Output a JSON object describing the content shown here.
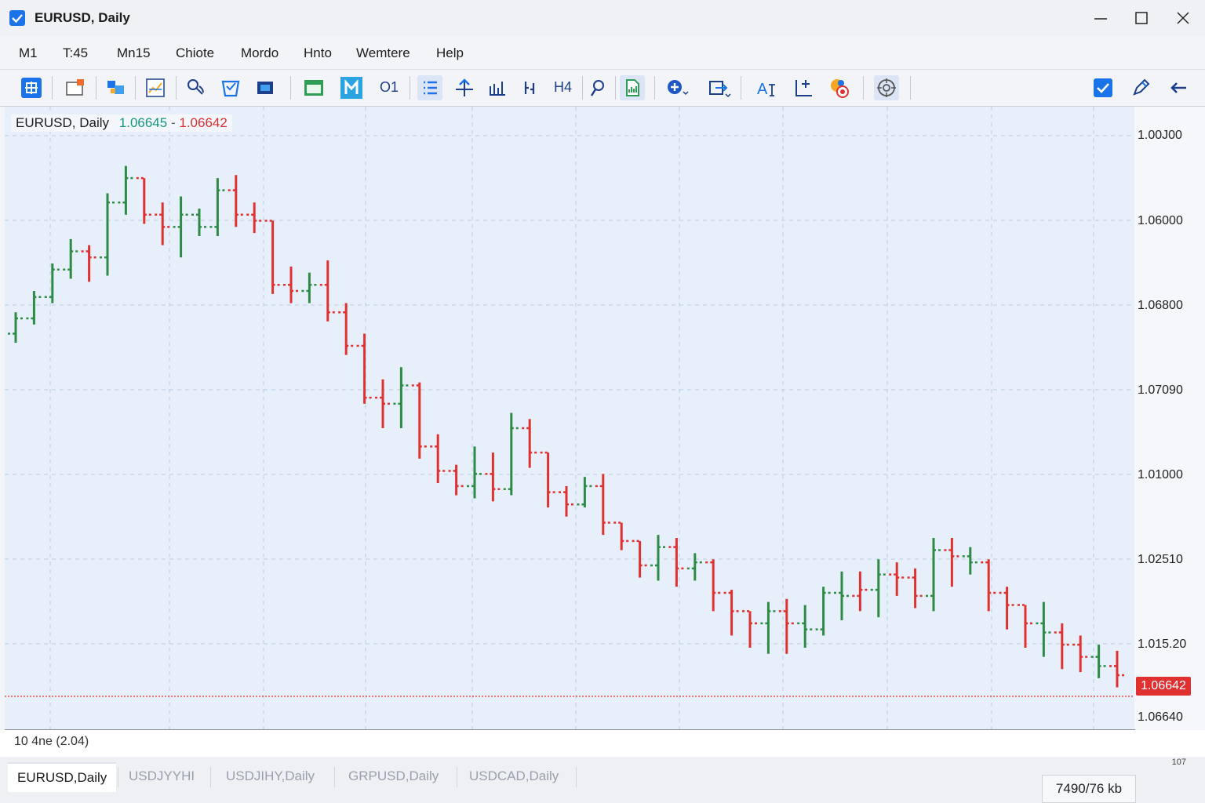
{
  "window": {
    "title": "EURUSD, Daily",
    "checkbox_icon": "check-icon"
  },
  "menu": {
    "items": [
      "M1",
      "T:45",
      "Mn15",
      "Chiote",
      "Mordo",
      "Hnto",
      "Wemtere",
      "Help"
    ]
  },
  "toolbar": {
    "text_buttons": {
      "o1": "O1",
      "h4": "H4"
    },
    "icons": [
      "new-chart-icon",
      "profiles-icon",
      "market-watch-icon",
      "navigator-icon",
      "signals-icon",
      "strategy-tester-icon",
      "terminal-icon",
      "bar-chart-icon",
      "candlestick-icon",
      "o1-timeframe",
      "line-list-icon",
      "crosshair-icon",
      "bar-chart-small-icon",
      "period-separator-icon",
      "h4-timeframe",
      "zoom-icon",
      "template-icon",
      "add-indicator-icon",
      "objects-icon",
      "text-label-icon",
      "cursor-icon",
      "color-icon",
      "target-icon",
      "autotrading-check-icon",
      "pencil-icon",
      "back-arrow-icon"
    ]
  },
  "chart": {
    "symbol_label": "EURUSD, Daily",
    "bid": "1.06645",
    "separator": "-",
    "ask": "1.06642",
    "current_price": "1.06642",
    "date_label": "10 4ne (2.04)"
  },
  "price_scale": {
    "labels": [
      "1.00J00",
      "1.06000",
      "1.06800",
      "1.07090",
      "1.01000",
      "1.02510",
      "1.015.20",
      "1.06640"
    ]
  },
  "chart_data": {
    "type": "bar",
    "ylim": [
      0,
      100
    ],
    "series": [
      {
        "bars": [
          {
            "o": 42,
            "h": 56,
            "l": 36,
            "c": 52,
            "up": true
          },
          {
            "o": 52,
            "h": 70,
            "l": 48,
            "c": 66,
            "up": true
          },
          {
            "o": 66,
            "h": 88,
            "l": 62,
            "c": 84,
            "up": true
          },
          {
            "o": 84,
            "h": 104,
            "l": 78,
            "c": 96,
            "up": true
          },
          {
            "o": 96,
            "h": 100,
            "l": 76,
            "c": 92,
            "up": false
          },
          {
            "o": 92,
            "h": 134,
            "l": 80,
            "c": 128,
            "up": true
          },
          {
            "o": 128,
            "h": 152,
            "l": 120,
            "c": 144,
            "up": true
          },
          {
            "o": 144,
            "h": 142,
            "l": 114,
            "c": 120,
            "up": false
          },
          {
            "o": 120,
            "h": 128,
            "l": 100,
            "c": 112,
            "up": false
          },
          {
            "o": 112,
            "h": 132,
            "l": 92,
            "c": 120,
            "up": true
          },
          {
            "o": 120,
            "h": 124,
            "l": 106,
            "c": 112,
            "up": true
          },
          {
            "o": 112,
            "h": 144,
            "l": 106,
            "c": 136,
            "up": true
          },
          {
            "o": 136,
            "h": 146,
            "l": 112,
            "c": 120,
            "up": false
          },
          {
            "o": 120,
            "h": 128,
            "l": 108,
            "c": 116,
            "up": false
          },
          {
            "o": 116,
            "h": 110,
            "l": 68,
            "c": 74,
            "up": false
          },
          {
            "o": 74,
            "h": 86,
            "l": 62,
            "c": 70,
            "up": false
          },
          {
            "o": 70,
            "h": 82,
            "l": 62,
            "c": 74,
            "up": true
          },
          {
            "o": 74,
            "h": 90,
            "l": 50,
            "c": 56,
            "up": false
          },
          {
            "o": 56,
            "h": 62,
            "l": 28,
            "c": 34,
            "up": false
          },
          {
            "o": 34,
            "h": 42,
            "l": -4,
            "c": 0,
            "up": false
          },
          {
            "o": 0,
            "h": 12,
            "l": -20,
            "c": -4,
            "up": false
          },
          {
            "o": -4,
            "h": 20,
            "l": -20,
            "c": 8,
            "up": true
          },
          {
            "o": 8,
            "h": 10,
            "l": -40,
            "c": -32,
            "up": false
          },
          {
            "o": -32,
            "h": -24,
            "l": -56,
            "c": -48,
            "up": false
          },
          {
            "o": -48,
            "h": -44,
            "l": -64,
            "c": -58,
            "up": false
          },
          {
            "o": -58,
            "h": -32,
            "l": -66,
            "c": -50,
            "up": true
          },
          {
            "o": -50,
            "h": -36,
            "l": -68,
            "c": -60,
            "up": false
          },
          {
            "o": -60,
            "h": -10,
            "l": -64,
            "c": -20,
            "up": true
          },
          {
            "o": -20,
            "h": -14,
            "l": -46,
            "c": -36,
            "up": false
          },
          {
            "o": -36,
            "h": -44,
            "l": -72,
            "c": -62,
            "up": false
          },
          {
            "o": -62,
            "h": -58,
            "l": -78,
            "c": -70,
            "up": false
          },
          {
            "o": -70,
            "h": -52,
            "l": -72,
            "c": -58,
            "up": true
          },
          {
            "o": -58,
            "h": -50,
            "l": -90,
            "c": -82,
            "up": false
          },
          {
            "o": -82,
            "h": -86,
            "l": -100,
            "c": -94,
            "up": false
          },
          {
            "o": -94,
            "h": -98,
            "l": -118,
            "c": -110,
            "up": false
          },
          {
            "o": -110,
            "h": -90,
            "l": -120,
            "c": -98,
            "up": true
          },
          {
            "o": -98,
            "h": -92,
            "l": -124,
            "c": -112,
            "up": false
          },
          {
            "o": -112,
            "h": -102,
            "l": -120,
            "c": -108,
            "up": true
          },
          {
            "o": -108,
            "h": -106,
            "l": -140,
            "c": -128,
            "up": false
          },
          {
            "o": -128,
            "h": -126,
            "l": -156,
            "c": -140,
            "up": false
          },
          {
            "o": -140,
            "h": -144,
            "l": -164,
            "c": -148,
            "up": false
          },
          {
            "o": -148,
            "h": -134,
            "l": -168,
            "c": -140,
            "up": true
          },
          {
            "o": -140,
            "h": -132,
            "l": -168,
            "c": -148,
            "up": false
          },
          {
            "o": -148,
            "h": -136,
            "l": -164,
            "c": -152,
            "up": true
          },
          {
            "o": -152,
            "h": -124,
            "l": -156,
            "c": -128,
            "up": true
          },
          {
            "o": -128,
            "h": -114,
            "l": -146,
            "c": -130,
            "up": true
          },
          {
            "o": -130,
            "h": -114,
            "l": -140,
            "c": -126,
            "up": false
          },
          {
            "o": -126,
            "h": -106,
            "l": -144,
            "c": -116,
            "up": true
          },
          {
            "o": -116,
            "h": -108,
            "l": -130,
            "c": -118,
            "up": false
          },
          {
            "o": -118,
            "h": -112,
            "l": -138,
            "c": -130,
            "up": false
          },
          {
            "o": -130,
            "h": -92,
            "l": -140,
            "c": -100,
            "up": true
          },
          {
            "o": -100,
            "h": -92,
            "l": -124,
            "c": -104,
            "up": false
          },
          {
            "o": -104,
            "h": -98,
            "l": -116,
            "c": -108,
            "up": true
          },
          {
            "o": -108,
            "h": -106,
            "l": -140,
            "c": -128,
            "up": false
          },
          {
            "o": -128,
            "h": -124,
            "l": -152,
            "c": -136,
            "up": false
          },
          {
            "o": -136,
            "h": -140,
            "l": -164,
            "c": -148,
            "up": false
          },
          {
            "o": -148,
            "h": -134,
            "l": -170,
            "c": -154,
            "up": true
          },
          {
            "o": -154,
            "h": -148,
            "l": -178,
            "c": -162,
            "up": false
          },
          {
            "o": -162,
            "h": -156,
            "l": -180,
            "c": -170,
            "up": false
          },
          {
            "o": -170,
            "h": -162,
            "l": -184,
            "c": -176,
            "up": true
          },
          {
            "o": -176,
            "h": -166,
            "l": -190,
            "c": -182,
            "up": false
          }
        ]
      }
    ],
    "colors": {
      "up": "#2e8b46",
      "down": "#e03131",
      "grid": "#b9cde3",
      "current_line": "#e03131"
    }
  },
  "status": {
    "tabs": [
      "EURUSD,Daily",
      "USDJYYHI",
      "USDJIHY,Daily",
      "GRPUSD,Daily",
      "USDCAD,Daily"
    ],
    "active_tab": 0,
    "small_count": "107",
    "memory": "7490/76 kb"
  }
}
